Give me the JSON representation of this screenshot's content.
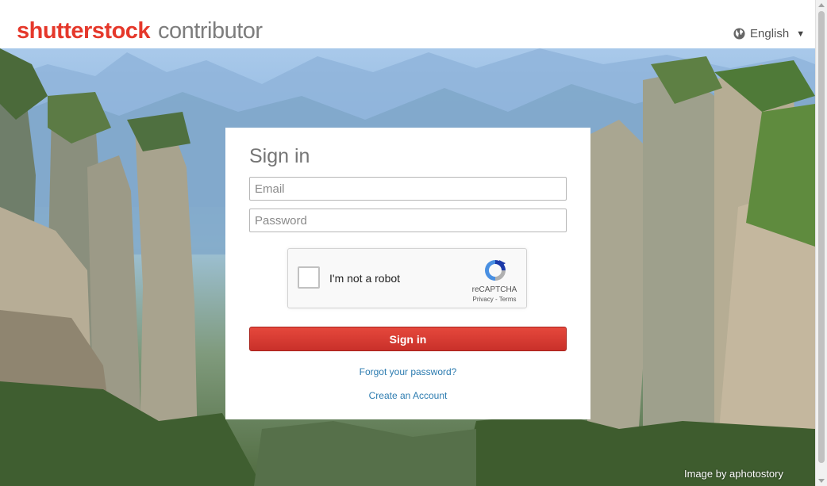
{
  "header": {
    "logo_brand": "shutterstock",
    "logo_product": "contributor",
    "language": "English",
    "language_icon": "globe-icon",
    "caret": "▼"
  },
  "signin": {
    "title": "Sign in",
    "email_placeholder": "Email",
    "password_placeholder": "Password",
    "button_label": "Sign in",
    "forgot_link": "Forgot your password?",
    "create_link": "Create an Account"
  },
  "captcha": {
    "label": "I'm not a robot",
    "brand": "reCAPTCHA",
    "links": "Privacy - Terms"
  },
  "background": {
    "credit": "Image by aphotostory"
  },
  "colors": {
    "brand_red": "#e5382b",
    "button_red": "#d2352b",
    "link_blue": "#2d7cb0"
  }
}
